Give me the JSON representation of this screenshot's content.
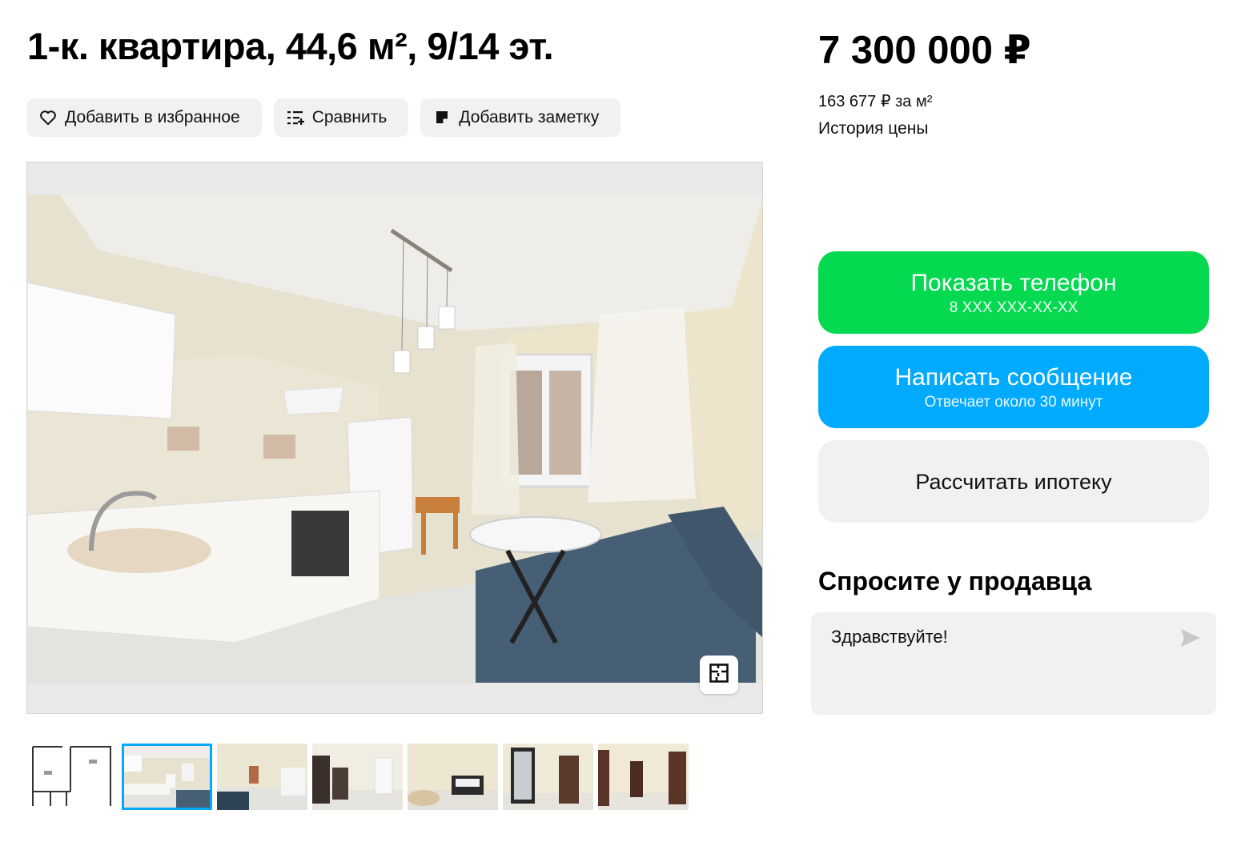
{
  "listing": {
    "title": "1-к. квартира, 44,6 м², 9/14 эт."
  },
  "actions": {
    "favorite_label": "Добавить в избранное",
    "compare_label": "Сравнить",
    "note_label": "Добавить заметку"
  },
  "gallery": {
    "thumbnail_count": 7,
    "active_thumbnail": 1,
    "plan_button_icon": "floor-plan-icon"
  },
  "price": {
    "value": "7 300 000 ₽",
    "per_m2": "163 677 ₽ за м²",
    "history_label": "История цены"
  },
  "contact": {
    "phone_label": "Показать телефон",
    "phone_masked": "8 XXX XXX-XX-XX",
    "message_label": "Написать сообщение",
    "message_sub": "Отвечает около 30 минут",
    "mortgage_label": "Рассчитать ипотеку"
  },
  "ask": {
    "title": "Спросите у продавца",
    "message_value": "Здравствуйте!"
  },
  "colors": {
    "phone_button": "#04d950",
    "message_button": "#00aaff",
    "secondary_button": "#f2f1f0",
    "active_thumb_outline": "#00aaff"
  }
}
